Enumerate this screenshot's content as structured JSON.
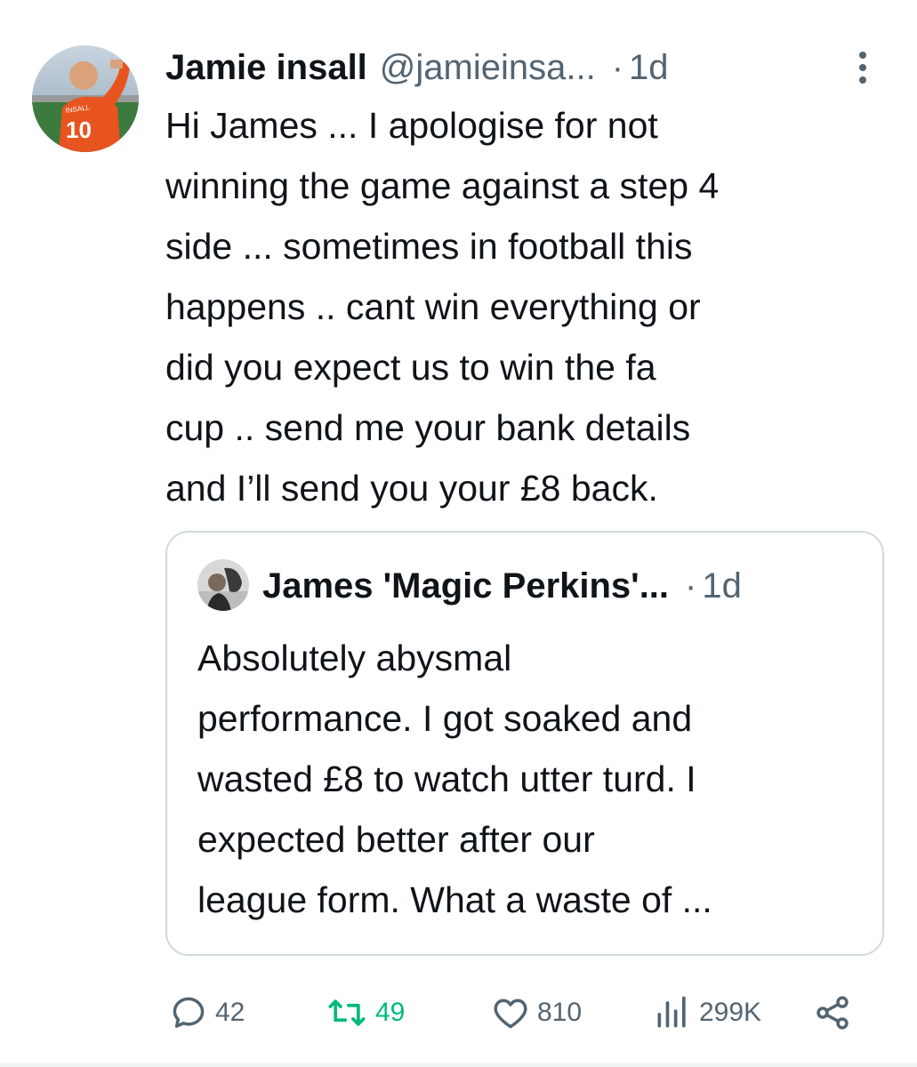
{
  "author": {
    "name": "Jamie insall",
    "handle": "@jamieinsa...",
    "time": "1d",
    "separator": "·",
    "avatar_shirt_text": "INSALL",
    "avatar_number": "10"
  },
  "tweet": {
    "text": "Hi James ... I apologise for not\nwinning the game against a step 4\nside ... sometimes in football this\nhappens .. cant win everything or\ndid you expect us to win the fa\ncup .. send me your bank details\nand I’ll send you your £8 back."
  },
  "quoted": {
    "name": "James 'Magic Perkins'...",
    "time": "1d",
    "separator": "·",
    "text": "Absolutely abysmal\nperformance. I got soaked and\nwasted £8 to watch utter turd. I\nexpected better after our\nleague form. What a waste of ..."
  },
  "actions": {
    "replies": "42",
    "reposts": "49",
    "likes": "810",
    "views": "299K"
  },
  "colors": {
    "text": "#0f1419",
    "muted": "#536471",
    "border": "#cfd9de",
    "repost_green": "#00ba7c"
  },
  "icons": [
    "more-icon",
    "reply-icon",
    "repost-icon",
    "like-icon",
    "views-icon",
    "share-icon"
  ]
}
